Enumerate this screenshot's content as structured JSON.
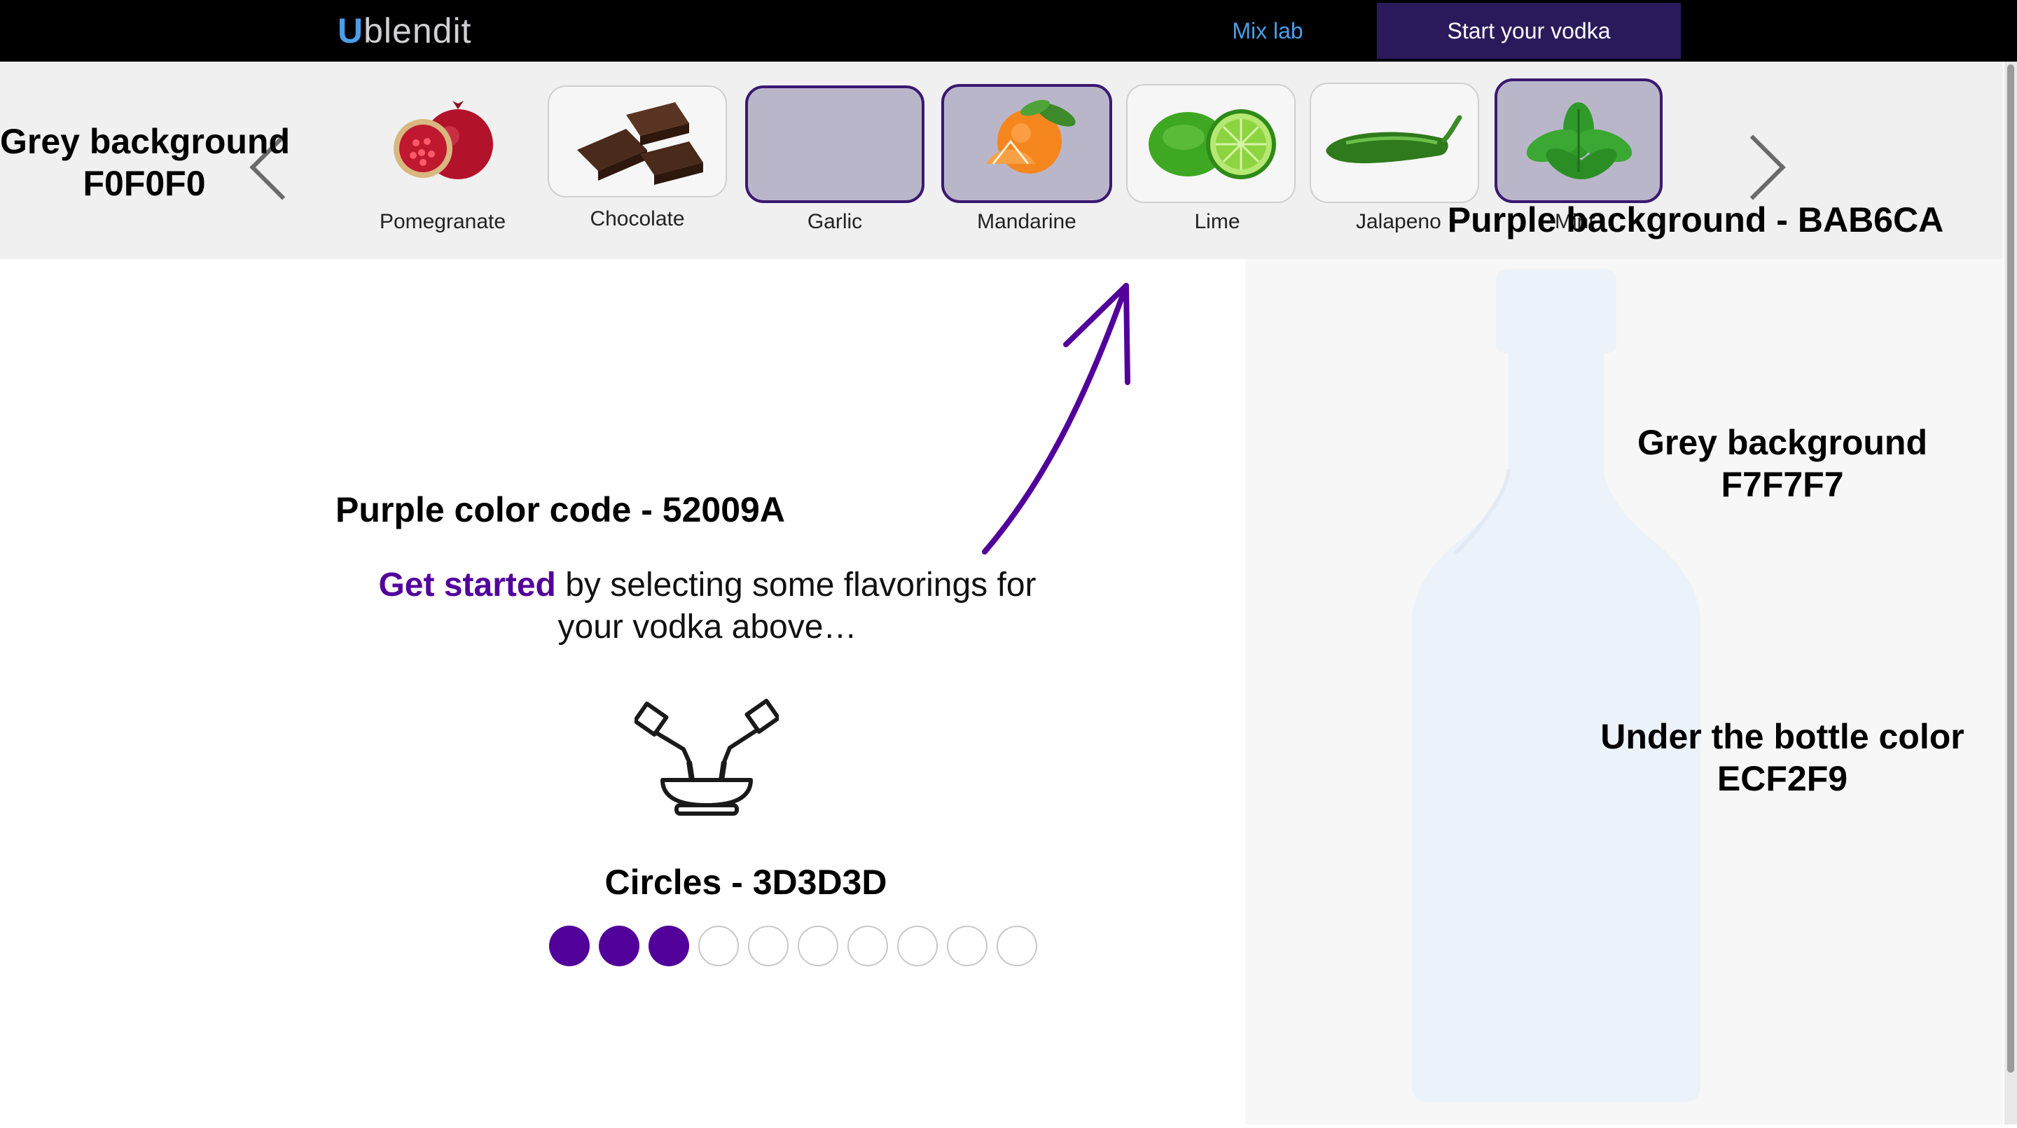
{
  "nav": {
    "logo_first": "U",
    "logo_rest": "blendit",
    "mix_lab": "Mix lab",
    "start_vodka": "Start your vodka"
  },
  "ingredients": [
    {
      "label": "Pomegranate",
      "selected": true
    },
    {
      "label": "Chocolate",
      "selected": false
    },
    {
      "label": "Garlic",
      "selected": true
    },
    {
      "label": "Mandarine",
      "selected": true
    },
    {
      "label": "Lime",
      "selected": false
    },
    {
      "label": "Jalapeno",
      "selected": false
    },
    {
      "label": "Mint",
      "selected": true
    }
  ],
  "annotations": {
    "grey_f0_line1": "Grey background",
    "grey_f0_line2": "F0F0F0",
    "purple_bg": "Purple background - BAB6CA",
    "purple_code": "Purple color code - 52009A",
    "grey_f7_line1": "Grey background",
    "grey_f7_line2": "F7F7F7",
    "bottle_line1": "Under the bottle color",
    "bottle_line2": "ECF2F9",
    "circles": "Circles - 3D3D3D"
  },
  "message": {
    "highlight": "Get started",
    "rest_line1": " by selecting some flavorings for",
    "line2": "your vodka above…"
  },
  "progress": {
    "filled": 3,
    "total": 10
  },
  "colors": {
    "accent_purple": "#52009A",
    "selected_card_bg": "#BAB6CA",
    "strip_bg": "#F0F0F0",
    "panel_bg": "#F7F7F7",
    "bottle": "#ECF2F9",
    "circles": "#3D3D3D"
  }
}
